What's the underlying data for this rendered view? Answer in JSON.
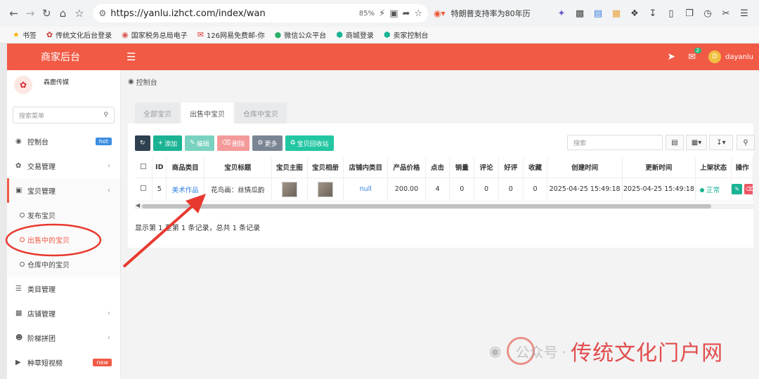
{
  "browser": {
    "url": "https://yanlu.izhct.com/index/wan",
    "zoom": "85%",
    "news": "特朗普支持率为80年历"
  },
  "bookmarks": [
    {
      "icon": "star",
      "label": "书签"
    },
    {
      "icon": "brand",
      "label": "传统文化后台登录"
    },
    {
      "icon": "tax",
      "label": "国家税务总局电子"
    },
    {
      "icon": "mail",
      "label": "126网易免费邮-你"
    },
    {
      "icon": "wechat",
      "label": "微信公众平台"
    },
    {
      "icon": "shop",
      "label": "商城登录"
    },
    {
      "icon": "shop2",
      "label": "卖家控制台"
    }
  ],
  "header": {
    "brand": "商家后台",
    "notif_count": "2",
    "avatar_letter": "D",
    "username": "dayanlu"
  },
  "sidebar": {
    "store_name": "森鹿传媒",
    "search_placeholder": "搜索菜单",
    "items": [
      {
        "label": "控制台",
        "tag": "hot"
      },
      {
        "label": "交易管理"
      },
      {
        "label": "宝贝管理"
      },
      {
        "label": "发布宝贝"
      },
      {
        "label": "出售中的宝贝"
      },
      {
        "label": "仓库中的宝贝"
      },
      {
        "label": "类目管理"
      },
      {
        "label": "店铺管理"
      },
      {
        "label": "阶梯拼团"
      },
      {
        "label": "种草短视频",
        "tag": "new"
      }
    ]
  },
  "breadcrumb": "控制台",
  "tabs": [
    "全部宝贝",
    "出售中宝贝",
    "仓库中宝贝"
  ],
  "toolbar": {
    "add": "添加",
    "edit": "编辑",
    "delete": "删除",
    "more": "更多",
    "recycle": "宝贝回收站",
    "search_placeholder": "搜索"
  },
  "table": {
    "headers": [
      "ID",
      "商品类目",
      "宝贝标题",
      "宝贝主图",
      "宝贝相册",
      "店铺内类目",
      "产品价格",
      "点击",
      "销量",
      "评论",
      "好评",
      "收藏",
      "创建时间",
      "更新时间",
      "上架状态",
      "操作"
    ],
    "rows": [
      {
        "id": "5",
        "category": "美术作品",
        "title": "花鸟画：丝情瓜韵",
        "shop_category": "null",
        "price": "200.00",
        "clicks": "4",
        "sales": "0",
        "comments": "0",
        "good": "0",
        "favorites": "0",
        "created": "2025-04-25 15:49:18",
        "updated": "2025-04-25 15:49:18",
        "status": "正常"
      }
    ]
  },
  "footer_note": "显示第 1 至第 1 条记录，总共 1 条记录",
  "watermark": {
    "text1": "公众号 · ",
    "text2": "传统文化门户网"
  },
  "colors": {
    "brand": "#f15a45",
    "green": "#1ab394",
    "blue": "#2f7fdf",
    "annotation": "#e8392f"
  }
}
